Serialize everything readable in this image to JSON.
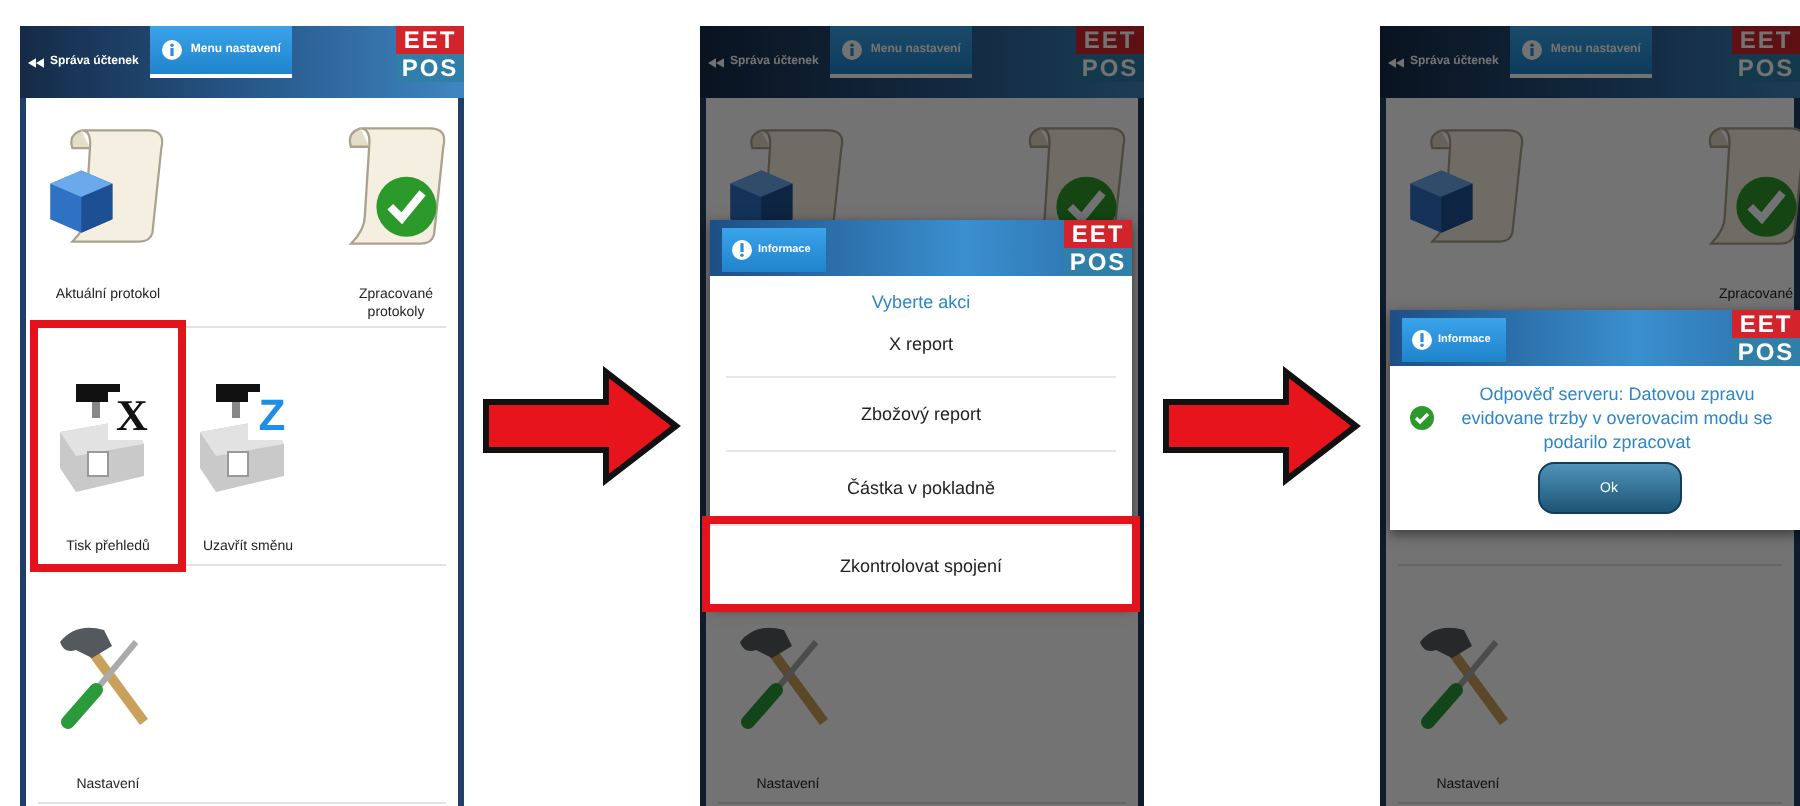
{
  "screens": [
    {
      "dimmed": false,
      "header": {
        "back_tab": "Správa účtenek",
        "active_tab": "Menu nastavení",
        "logo_top": "EET",
        "logo_bottom": "POS"
      },
      "tile_rows": [
        [
          {
            "kind": "recycle",
            "label": "Aktuální protokol",
            "highlighted": false
          },
          {
            "kind": "blank"
          },
          {
            "kind": "check",
            "label": "Zpracované protokoly",
            "highlighted": false
          }
        ],
        [
          {
            "kind": "register",
            "letter": "X",
            "label": "Tisk přehledů",
            "highlighted": true
          },
          {
            "kind": "register",
            "letter": "Z",
            "label": "Uzavřít směnu",
            "highlighted": false
          }
        ],
        [
          {
            "kind": "tools",
            "label": "Nastavení",
            "highlighted": false
          }
        ]
      ]
    },
    {
      "dimmed": true,
      "header": {
        "back_tab": "Správa účtenek",
        "active_tab": "Menu nastavení",
        "logo_top": "EET",
        "logo_bottom": "POS"
      },
      "tile_rows": [
        [
          {
            "kind": "recycle",
            "highlighted": false
          },
          {
            "kind": "blank"
          },
          {
            "kind": "check",
            "highlighted": false
          }
        ],
        [
          {
            "kind": "blank"
          }
        ],
        [
          {
            "kind": "tools",
            "label": "Nastavení",
            "highlighted": false
          }
        ]
      ],
      "dialog": {
        "kind": "menu",
        "tab": "Informace",
        "logo_top": "EET",
        "logo_bottom": "POS",
        "title": "Vyberte akci",
        "options": [
          {
            "label": "X report",
            "highlighted": false
          },
          {
            "label": "Zbožový report",
            "highlighted": false
          },
          {
            "label": "Částka v pokladně",
            "highlighted": false
          },
          {
            "label": "Zkontrolovat spojení",
            "highlighted": true
          }
        ]
      }
    },
    {
      "dimmed": true,
      "header": {
        "back_tab": "Správa účtenek",
        "active_tab": "Menu nastavení",
        "logo_top": "EET",
        "logo_bottom": "POS"
      },
      "tile_rows": [
        [
          {
            "kind": "recycle",
            "highlighted": false
          },
          {
            "kind": "blank"
          },
          {
            "kind": "check",
            "label": "Zpracované",
            "highlighted": false
          }
        ],
        [
          {
            "kind": "blank"
          }
        ],
        [
          {
            "kind": "tools",
            "label": "Nastavení",
            "highlighted": false
          }
        ]
      ],
      "dialog": {
        "kind": "message",
        "tab": "Informace",
        "logo_top": "EET",
        "logo_bottom": "POS",
        "message": "Odpověď serveru: Datovou zpravu evidovane trzby v overovacim modu se podarilo zpracovat",
        "button": "Ok"
      }
    }
  ]
}
